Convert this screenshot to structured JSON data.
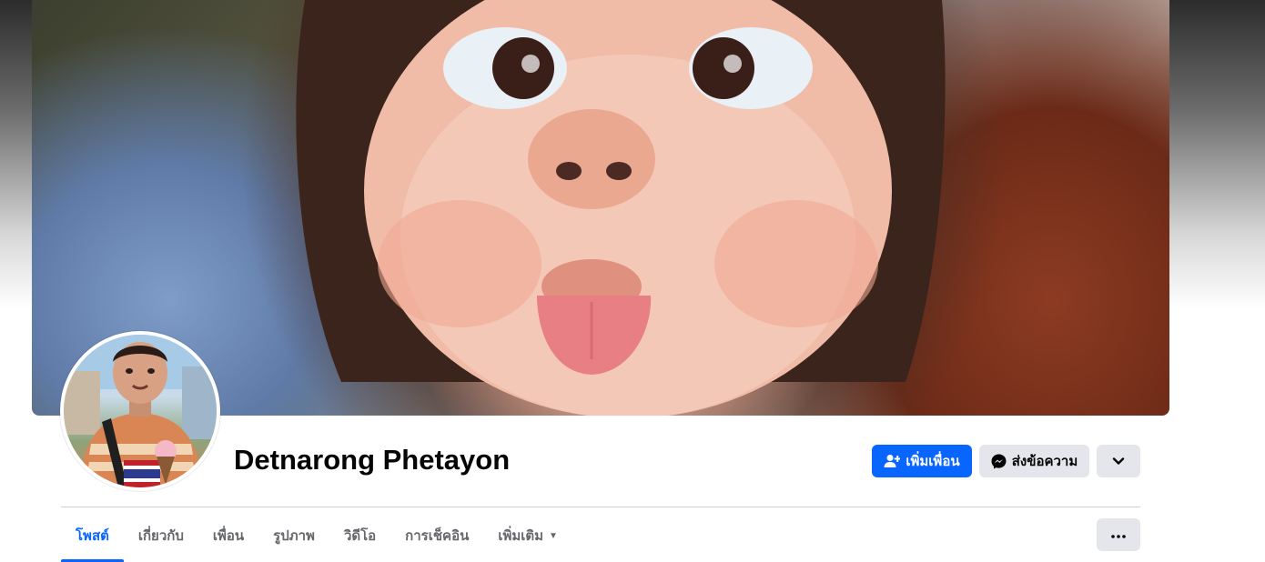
{
  "profile": {
    "name": "Detnarong Phetayon"
  },
  "actions": {
    "add_friend_label": "เพิ่มเพื่อน",
    "message_label": "ส่งข้อความ"
  },
  "tabs": [
    {
      "label": "โพสต์",
      "active": true
    },
    {
      "label": "เกี่ยวกับ",
      "active": false
    },
    {
      "label": "เพื่อน",
      "active": false
    },
    {
      "label": "รูปภาพ",
      "active": false
    },
    {
      "label": "วิดีโอ",
      "active": false
    },
    {
      "label": "การเช็คอิน",
      "active": false
    },
    {
      "label": "เพิ่มเติม",
      "active": false
    }
  ],
  "icons": {
    "add_friend": "add-friend-icon",
    "messenger": "messenger-icon",
    "more_dropdown": "chevron-down-icon",
    "overflow": "more-dots-icon",
    "tab_more": "caret-down-icon"
  },
  "colors": {
    "accent": "#0866ff",
    "secondary_button": "#e4e6eb",
    "text_primary": "#050505",
    "text_secondary": "#65676b"
  }
}
